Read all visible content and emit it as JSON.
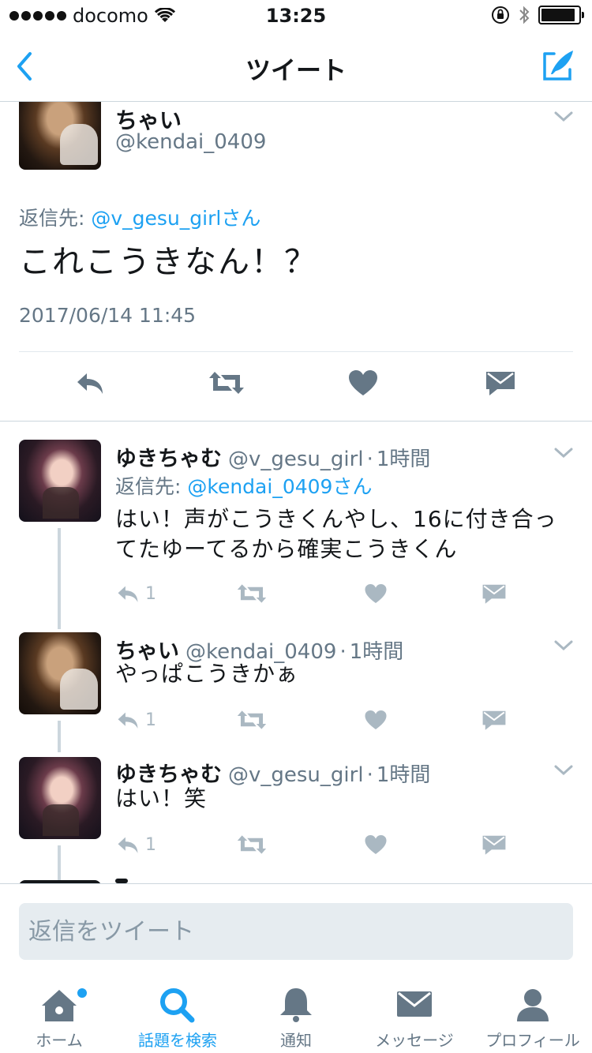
{
  "status_bar": {
    "carrier": "docomo",
    "time": "13:25"
  },
  "nav": {
    "title": "ツイート"
  },
  "main_tweet": {
    "name": "ちゃい",
    "handle": "@kendai_0409",
    "reply_prefix": "返信先: ",
    "reply_to": "@v_gesu_girlさん",
    "text": "これこうきなん！？",
    "timestamp": "2017/06/14 11:45"
  },
  "replies": [
    {
      "name": "ゆきちゃむ",
      "handle": "@v_gesu_girl",
      "dot": "·",
      "time": "1時間",
      "reply_prefix": "返信先: ",
      "reply_to": "@kendai_0409さん",
      "text": "はい！声がこうきくんやし、16に付き合ってたゆーてるから確実こうきくん",
      "reply_count": "1"
    },
    {
      "name": "ちゃい",
      "handle": "@kendai_0409",
      "dot": "·",
      "time": "1時間",
      "text": "やっぱこうきかぁ",
      "reply_count": "1"
    },
    {
      "name": "ゆきちゃむ",
      "handle": "@v_gesu_girl",
      "dot": "·",
      "time": "1時間",
      "text": "はい！笑",
      "reply_count": "1"
    }
  ],
  "reply_box": {
    "placeholder": "返信をツイート"
  },
  "tabs": [
    {
      "label": "ホーム",
      "icon": "home-icon"
    },
    {
      "label": "話題を検索",
      "icon": "search-icon"
    },
    {
      "label": "通知",
      "icon": "bell-icon"
    },
    {
      "label": "メッセージ",
      "icon": "envelope-icon"
    },
    {
      "label": "プロフィール",
      "icon": "profile-icon"
    }
  ],
  "colors": {
    "accent": "#1da1f2",
    "text": "#14171a",
    "secondary": "#657786",
    "icon_gray": "#657786",
    "icon_light": "#aab8c2"
  }
}
